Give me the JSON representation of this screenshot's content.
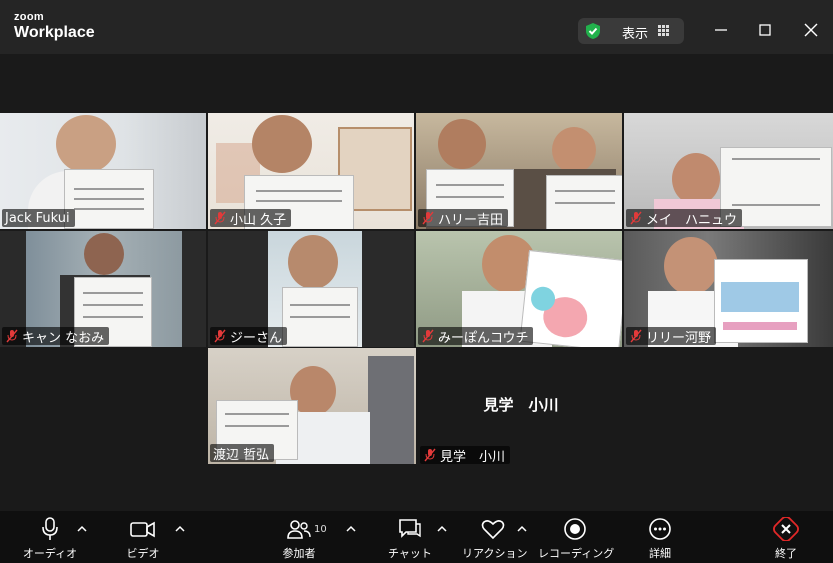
{
  "app": {
    "brand_small": "zoom",
    "brand_large": "Workplace"
  },
  "header": {
    "view_label": "表示"
  },
  "participants": [
    {
      "name": "Jack Fukui",
      "muted": false
    },
    {
      "name": "小山 久子",
      "muted": true
    },
    {
      "name": "ハリー吉田",
      "muted": true
    },
    {
      "name": "メイ　ハニュウ",
      "muted": true
    },
    {
      "name": "キャン なおみ",
      "muted": true
    },
    {
      "name": "ジーさん",
      "muted": true
    },
    {
      "name": "みーぽんコウチ",
      "muted": true
    },
    {
      "name": "リリー河野",
      "muted": true
    },
    {
      "name": "渡辺 哲弘",
      "muted": false,
      "active_speaker": true
    },
    {
      "name": "見学　小川",
      "muted": true,
      "video_off": true
    }
  ],
  "video_off_display_name": "見学　小川",
  "toolbar": {
    "audio": "オーディオ",
    "video": "ビデオ",
    "participants": "参加者",
    "participants_count": "10",
    "chat": "チャット",
    "reactions": "リアクション",
    "record": "レコーディング",
    "more": "詳細",
    "end": "終了"
  },
  "colors": {
    "active_border": "#3ecf6a",
    "end_red": "#e02828",
    "shield_green": "#22b14c"
  }
}
